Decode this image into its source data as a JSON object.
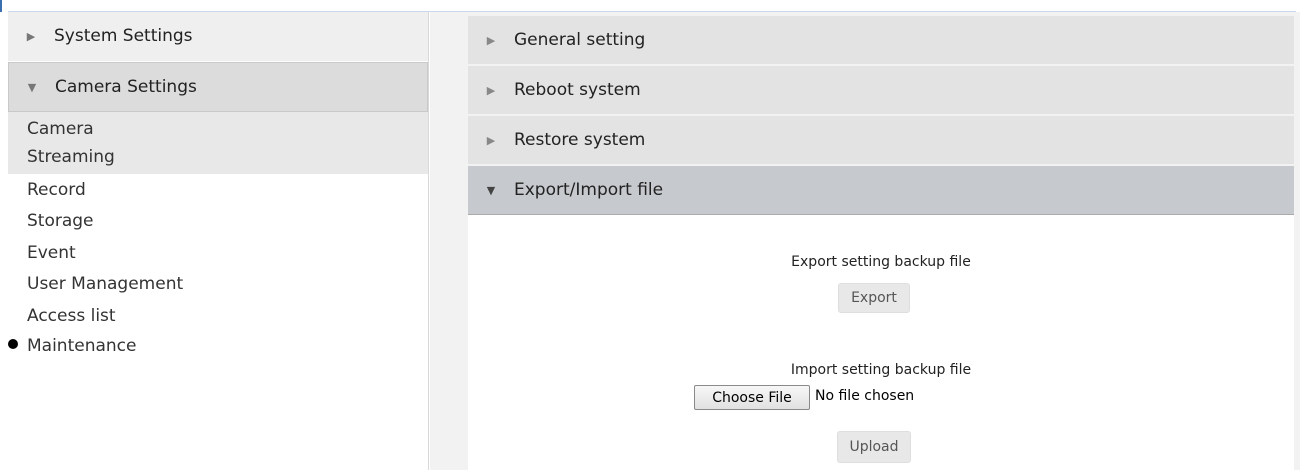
{
  "sidebar": {
    "system_settings": "System Settings",
    "camera_settings": "Camera Settings",
    "items": [
      "Camera",
      "Streaming",
      "Record",
      "Storage",
      "Event",
      "User Management",
      "Access list",
      "Maintenance"
    ]
  },
  "accordion": {
    "general": "General setting",
    "reboot": "Reboot system",
    "restore": "Restore system",
    "export_import": "Export/Import file"
  },
  "panel": {
    "export_label": "Export setting backup file",
    "export_button": "Export",
    "import_label": "Import setting backup file",
    "choose_file": "Choose File",
    "file_status": "No file chosen",
    "upload_button": "Upload"
  },
  "icons": {
    "collapsed": "triangle-right",
    "expanded": "triangle-down",
    "active_marker": "bullet"
  },
  "colors": {
    "accent": "#3a6fb0",
    "selected_header": "#c6c9ce"
  }
}
